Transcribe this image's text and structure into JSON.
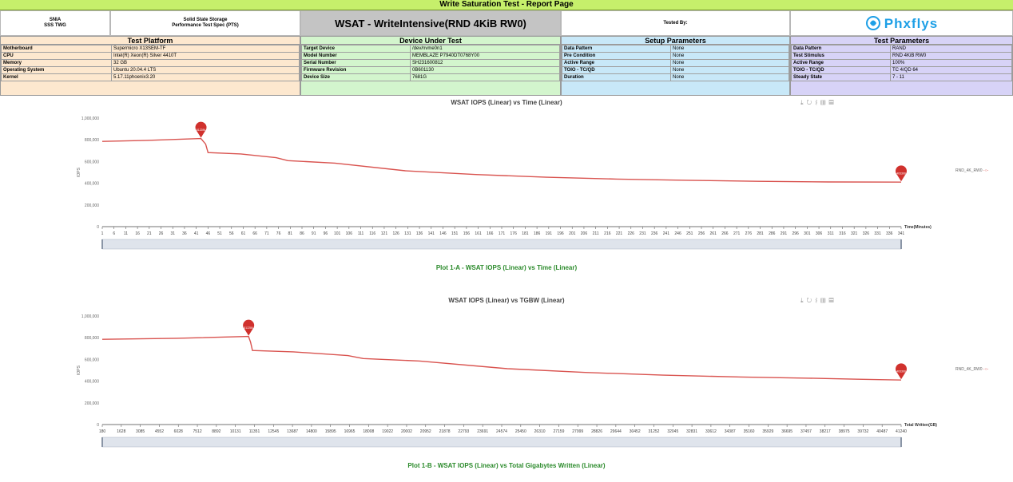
{
  "report_title": "Write Saturation Test - Report Page",
  "header": {
    "org_line1": "SNIA",
    "org_line2": "SSS TWG",
    "spec_line1": "Solid State Storage",
    "spec_line2": "Performance Test Spec (PTS)",
    "test_title": "WSAT - WriteIntensive(RND 4KiB RW0)",
    "tested_by": "Tested By:",
    "logo_text": "Phxflys"
  },
  "sections": {
    "platform": {
      "title": "Test Platform",
      "rows": [
        [
          "Motherboard",
          "Supermicro X13SEM-TF"
        ],
        [
          "CPU",
          "Intel(R) Xeon(R) Silver 4410T"
        ],
        [
          "Memory",
          "32 GB"
        ],
        [
          "Operating System",
          "Ubuntu 20.04.4 LTS"
        ],
        [
          "Kernel",
          "5.17.11phoenix3.20"
        ]
      ]
    },
    "dut": {
      "title": "Device Under Test",
      "rows": [
        [
          "Target Device",
          "/dev/nvme0n1"
        ],
        [
          "Model Number",
          "MEMBLAZE P7940DT0768Y00"
        ],
        [
          "Serial Number",
          "SH231600812"
        ],
        [
          "Firmware Revision",
          "0B601130"
        ],
        [
          "Device Size",
          "7681G"
        ]
      ]
    },
    "setup": {
      "title": "Setup Parameters",
      "rows": [
        [
          "Data Pattern",
          "None"
        ],
        [
          "Pre Condition",
          "None"
        ],
        [
          "Active Range",
          "None"
        ],
        [
          "TOIO - TC/QD",
          "None"
        ],
        [
          "Duration",
          "None"
        ]
      ]
    },
    "test": {
      "title": "Test Parameters",
      "rows": [
        [
          "Data Pattern",
          "RAND"
        ],
        [
          "Test Stimulus",
          "RND 4KiB RW0"
        ],
        [
          "Active Range",
          "100%"
        ],
        [
          "TOIO - TC/QD",
          "TC 4/QD 64"
        ],
        [
          "Steady State",
          "7 - 11"
        ]
      ]
    }
  },
  "colors": {
    "series": "#d9534f",
    "banner": "#c6ef6b",
    "caption": "#2a8a2a",
    "logo": "#1d9fe6"
  },
  "chart_data": [
    {
      "type": "line",
      "title": "WSAT IOPS (Linear) vs Time (Linear)",
      "caption": "Plot 1-A - WSAT IOPS (Linear) vs Time (Linear)",
      "xlabel": "Time(Minutes)",
      "ylabel": "IOPS",
      "ylim": [
        0,
        1000000
      ],
      "yticks": [
        "0",
        "200,000",
        "400,000",
        "600,000",
        "800,000",
        "1,000,000"
      ],
      "xticks": [
        "1",
        "6",
        "11",
        "16",
        "21",
        "26",
        "31",
        "36",
        "41",
        "46",
        "51",
        "56",
        "61",
        "66",
        "71",
        "76",
        "81",
        "86",
        "91",
        "96",
        "101",
        "106",
        "111",
        "116",
        "121",
        "126",
        "131",
        "136",
        "141",
        "146",
        "151",
        "156",
        "161",
        "166",
        "171",
        "176",
        "181",
        "186",
        "191",
        "196",
        "201",
        "206",
        "211",
        "216",
        "221",
        "226",
        "231",
        "236",
        "241",
        "246",
        "251",
        "256",
        "261",
        "266",
        "271",
        "276",
        "281",
        "286",
        "291",
        "296",
        "301",
        "306",
        "311",
        "316",
        "321",
        "326",
        "331",
        "336",
        "341"
      ],
      "series": [
        {
          "name": "RND_4K_RW0",
          "x": [
            1,
            20,
            43,
            45,
            46,
            60,
            75,
            80,
            100,
            130,
            160,
            190,
            220,
            250,
            280,
            310,
            341
          ],
          "y": [
            785000,
            795000,
            812000,
            760000,
            682000,
            670000,
            635000,
            608000,
            585000,
            515000,
            480000,
            455000,
            438000,
            427000,
            418000,
            412000,
            410000
          ]
        }
      ],
      "markers": [
        {
          "label": "812284",
          "x": 43,
          "y": 812000
        },
        {
          "label": "403399",
          "x": 341,
          "y": 410000
        }
      ],
      "legend": "right",
      "grid": false
    },
    {
      "type": "line",
      "title": "WSAT IOPS (Linear) vs TGBW (Linear)",
      "caption": "Plot 1-B - WSAT IOPS (Linear) vs Total Gigabytes Written (Linear)",
      "xlabel": "Total Written(GB)",
      "ylabel": "IOPS",
      "ylim": [
        0,
        1000000
      ],
      "yticks": [
        "0",
        "200,000",
        "400,000",
        "600,000",
        "800,000",
        "1,000,000"
      ],
      "xticks": [
        "180",
        "1628",
        "3085",
        "4552",
        "6028",
        "7512",
        "8892",
        "10131",
        "11351",
        "12545",
        "13687",
        "14800",
        "15895",
        "16965",
        "18008",
        "19022",
        "20002",
        "20952",
        "21878",
        "22793",
        "23691",
        "24574",
        "25450",
        "26310",
        "27159",
        "27999",
        "28826",
        "29644",
        "30452",
        "31252",
        "32045",
        "32831",
        "33612",
        "34387",
        "35160",
        "35929",
        "36695",
        "37457",
        "38217",
        "38975",
        "39732",
        "40487",
        "41240"
      ],
      "series": [
        {
          "name": "RND_4K_RW0",
          "x": [
            180,
            4000,
            7700,
            7800,
            7900,
            10000,
            12800,
            13600,
            16500,
            21000,
            25000,
            29000,
            33000,
            36500,
            39000,
            41240
          ],
          "y": [
            785000,
            795000,
            812000,
            760000,
            682000,
            670000,
            635000,
            608000,
            585000,
            515000,
            480000,
            455000,
            438000,
            427000,
            418000,
            410000
          ]
        }
      ],
      "markers": [
        {
          "label": "812284",
          "x": 7700,
          "y": 812000
        },
        {
          "label": "403399",
          "x": 41240,
          "y": 410000
        }
      ],
      "legend": "right",
      "grid": false
    }
  ],
  "toolbox_icons": [
    "download-icon",
    "refresh-icon",
    "line-icon",
    "bar-icon",
    "data-view-icon"
  ]
}
